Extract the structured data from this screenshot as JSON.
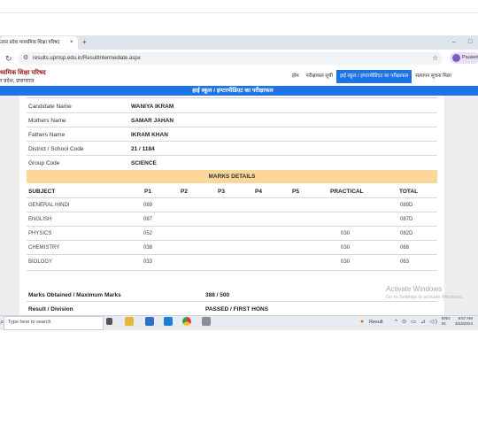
{
  "browser": {
    "tab_title": "उत्तर प्रदेश माध्यमिक शिक्षा परिषद",
    "tab_close": "×",
    "new_tab": "+",
    "minimize": "–",
    "maximize": "□",
    "reload": "↻",
    "site_info": "⚙",
    "url": "results.upmsp.edu.in/ResultIntermediate.aspx",
    "bookmark": "☆",
    "profile_label": "Paused"
  },
  "site": {
    "logo_line1": "ध्यमिक शिक्षा परिषद",
    "logo_line2": "र प्रदेश, प्रयागराज",
    "nav": [
      {
        "label": "होम"
      },
      {
        "label": "परीक्षाफल सूची"
      },
      {
        "label": "हाई स्कूल / इण्टरमीडिएट का परीक्षाफल"
      },
      {
        "label": "सत्यापन सूचना मिला"
      }
    ],
    "heading": "हाई स्कूल / इण्टरमीडिएट का परीक्षाफल"
  },
  "candidate": [
    {
      "label": "Candidate Name",
      "value": "WANIYA IKRAM"
    },
    {
      "label": "Mothers Name",
      "value": "SAMAR JAHAN"
    },
    {
      "label": "Fathers Name",
      "value": "IKRAM KHAN"
    },
    {
      "label": "District / School Code",
      "value": "21 / 1184"
    },
    {
      "label": "Group Code",
      "value": "SCIENCE"
    }
  ],
  "marks": {
    "title": "MARKS DETAILS",
    "headers": [
      "SUBJECT",
      "P1",
      "P2",
      "P3",
      "P4",
      "P5",
      "PRACTICAL",
      "TOTAL"
    ],
    "rows": [
      [
        "GENERAL HINDI",
        "089",
        "",
        "",
        "",
        "",
        "",
        "089D"
      ],
      [
        "ENGLISH",
        "087",
        "",
        "",
        "",
        "",
        "",
        "087D"
      ],
      [
        "PHYSICS",
        "052",
        "",
        "",
        "",
        "",
        "030",
        "082D"
      ],
      [
        "CHEMISTRY",
        "038",
        "",
        "",
        "",
        "",
        "030",
        "068"
      ],
      [
        "BIOLOGY",
        "033",
        "",
        "",
        "",
        "",
        "030",
        "063"
      ]
    ]
  },
  "summary": [
    {
      "label": "Marks Obtained / Maximum Marks",
      "value": "388 / 500"
    },
    {
      "label": "Result / Division",
      "value": "PASSED / FIRST HONS"
    }
  ],
  "watermark": {
    "line1": "Activate Windows",
    "line2": "Go to Settings to activate Windows."
  },
  "taskbar": {
    "start": "⌕",
    "search_placeholder": "Type here to search",
    "weather": "Result",
    "tray": "^ ⊙ ▭ ⊿ ◁)",
    "lang_1": "ENG",
    "lang_2": "IN",
    "time": "9:57 AM",
    "date": "3/22/2024"
  },
  "colors": {
    "accent": "#1e73e6",
    "marks_band": "#fbd89a",
    "logo_red": "#9b1c1c"
  }
}
